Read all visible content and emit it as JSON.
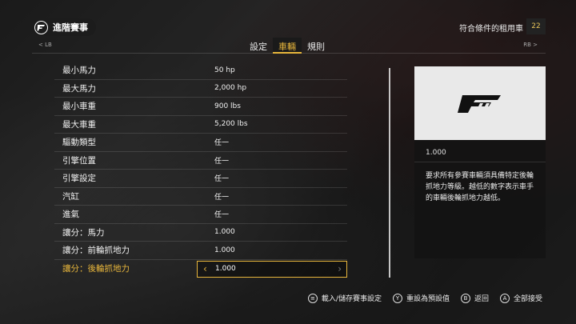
{
  "header": {
    "title": "進階賽事",
    "logo": "forza-logo-icon"
  },
  "eligible": {
    "label": "符合條件的租用車",
    "count": "22"
  },
  "tabbar": {
    "lb": "< LB",
    "rb": "RB >",
    "tabs": [
      {
        "label": "設定"
      },
      {
        "label": "車輛"
      },
      {
        "label": "規則"
      }
    ],
    "active_index": 1
  },
  "settings": [
    {
      "label": "最小馬力",
      "value": "50  hp"
    },
    {
      "label": "最大馬力",
      "value": "2,000  hp"
    },
    {
      "label": "最小車重",
      "value": "900  lbs"
    },
    {
      "label": "最大車重",
      "value": "5,200  lbs"
    },
    {
      "label": "驅動類型",
      "value": "任一"
    },
    {
      "label": "引擎位置",
      "value": "任一"
    },
    {
      "label": "引擎設定",
      "value": "任一"
    },
    {
      "label": "汽缸",
      "value": "任一"
    },
    {
      "label": "進氣",
      "value": "任一"
    },
    {
      "label": "讓分：馬力",
      "value": "1.000"
    },
    {
      "label": "讓分：前輪抓地力",
      "value": "1.000"
    },
    {
      "label": "讓分：後輪抓地力",
      "value": "1.000"
    }
  ],
  "selected_index": 11,
  "panel": {
    "value": "1.000",
    "description": "要求所有參賽車輛須具備特定後輪抓地力等級。越低的數字表示車手的車輛後輪抓地力越低。"
  },
  "footer": [
    {
      "icon": "menu-button-icon",
      "glyph": "≡",
      "label": "載入/儲存賽事設定"
    },
    {
      "icon": "y-button-icon",
      "glyph": "Y",
      "label": "重設為預設值"
    },
    {
      "icon": "b-button-icon",
      "glyph": "B",
      "label": "返回"
    },
    {
      "icon": "a-button-icon",
      "glyph": "A",
      "label": "全部接受"
    }
  ]
}
